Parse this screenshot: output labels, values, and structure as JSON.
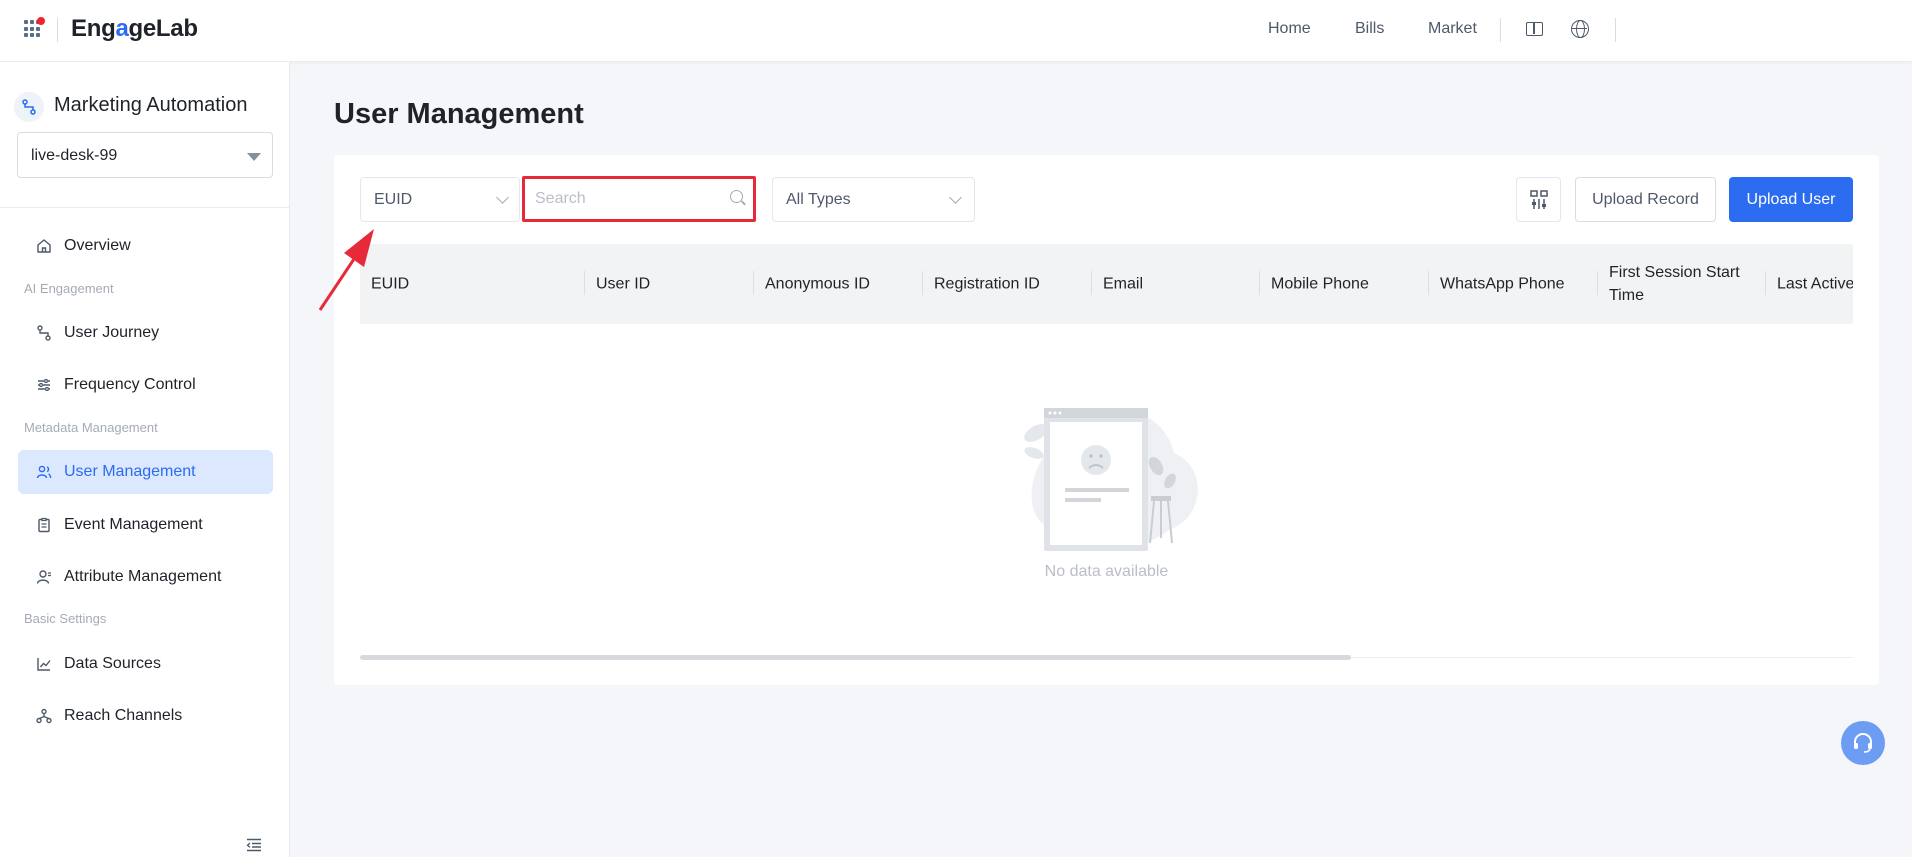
{
  "topbar": {
    "logo_text_1": "Eng",
    "logo_text_g": "a",
    "logo_text_2": "geLab",
    "nav": [
      "Home",
      "Bills",
      "Market"
    ]
  },
  "sidebar": {
    "product_title": "Marketing Automation",
    "project": "live-desk-99",
    "items": [
      {
        "label": "Overview",
        "icon": "home-icon"
      },
      {
        "group": "AI Engagement"
      },
      {
        "label": "User Journey",
        "icon": "journey-icon"
      },
      {
        "label": "Frequency Control",
        "icon": "sliders-icon"
      },
      {
        "group": "Metadata Management"
      },
      {
        "label": "User Management",
        "icon": "users-icon",
        "active": true
      },
      {
        "label": "Event Management",
        "icon": "clipboard-icon"
      },
      {
        "label": "Attribute Management",
        "icon": "user-icon"
      },
      {
        "group": "Basic Settings"
      },
      {
        "label": "Data Sources",
        "icon": "chart-line-icon"
      },
      {
        "label": "Reach Channels",
        "icon": "network-icon"
      }
    ]
  },
  "main": {
    "title": "User Management",
    "filter_field": "EUID",
    "search_placeholder": "Search",
    "type_filter": "All Types",
    "upload_record_label": "Upload Record",
    "upload_user_label": "Upload User",
    "columns": [
      "EUID",
      "User ID",
      "Anonymous ID",
      "Registration ID",
      "Email",
      "Mobile Phone",
      "WhatsApp Phone",
      "First Session Start Time",
      "Last Active"
    ],
    "empty_text": "No data available"
  },
  "colors": {
    "accent": "#2c6cf0",
    "highlight_box": "#e62a3a",
    "active_bg": "#dbe8fd"
  }
}
